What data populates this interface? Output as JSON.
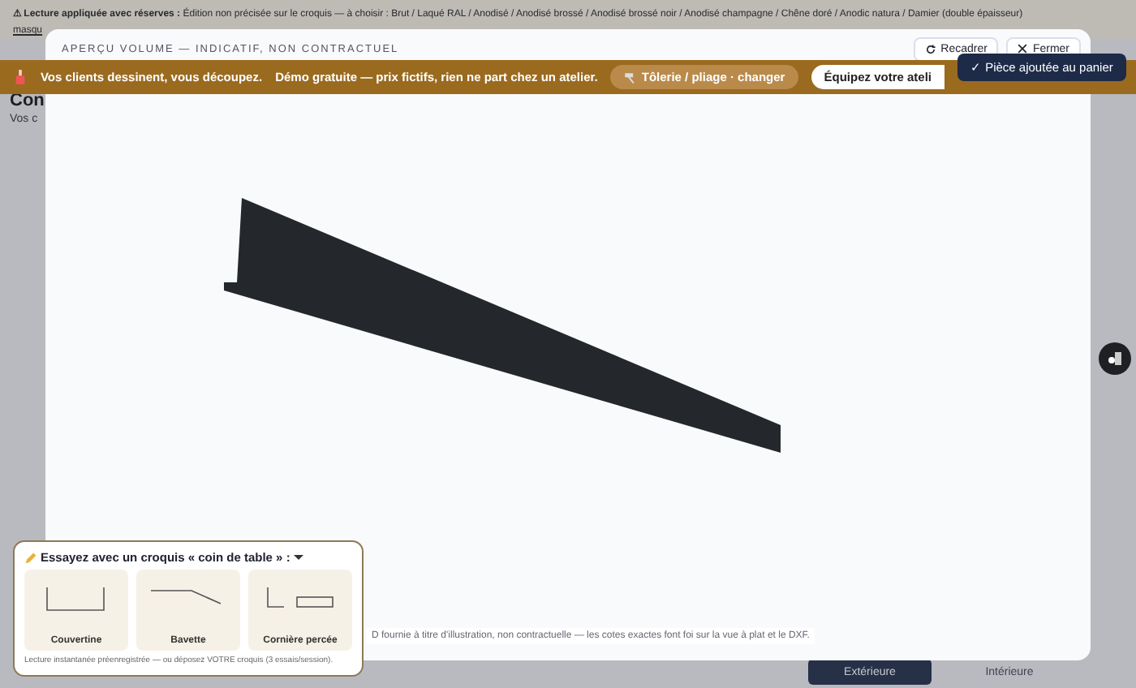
{
  "page": {
    "warning_label": "⚠ Lecture appliquée avec réserves :",
    "warning_text": "Édition non précisée sur le croquis — à choisir : Brut / Laqué RAL / Anodisé / Anodisé brossé / Anodisé brossé noir / Anodisé champagne / Chêne doré / Anodic natura / Damier (double épaisseur)",
    "warning_link": "masqu",
    "title": "Con",
    "subtitle": "Vos c",
    "face_buttons": [
      {
        "label": "Extérieure",
        "selected": true
      },
      {
        "label": "Intérieure",
        "selected": false
      }
    ]
  },
  "modal": {
    "title": "APERÇU VOLUME — INDICATIF, NON CONTRACTUEL",
    "buttons": [
      {
        "kind": "recenter",
        "label": "Recadrer"
      },
      {
        "kind": "close",
        "label": "Fermer"
      }
    ],
    "caption": "D fournie à titre d'illustration, non contractuelle — les cotes exactes font foi sur la vue à plat et le DXF."
  },
  "banner": {
    "text": "Vos clients dessinent, vous découpez.",
    "demo": "Démo gratuite — prix fictifs, rien ne part chez un atelier.",
    "trade_button": "Tôlerie / pliage · changer",
    "cta": "Équipez votre ateli"
  },
  "toast": "✓ Pièce ajoutée au panier",
  "samples": {
    "title": "Essayez avec un croquis « coin de table » :",
    "items": [
      {
        "kind": "coping",
        "label": "Couvertine"
      },
      {
        "kind": "flashing",
        "label": "Bavette"
      },
      {
        "kind": "angle",
        "label": "Cornière percée"
      }
    ],
    "footer": "Lecture instantanée préenregistrée — ou déposez VOTRE croquis (3 essais/session)."
  }
}
